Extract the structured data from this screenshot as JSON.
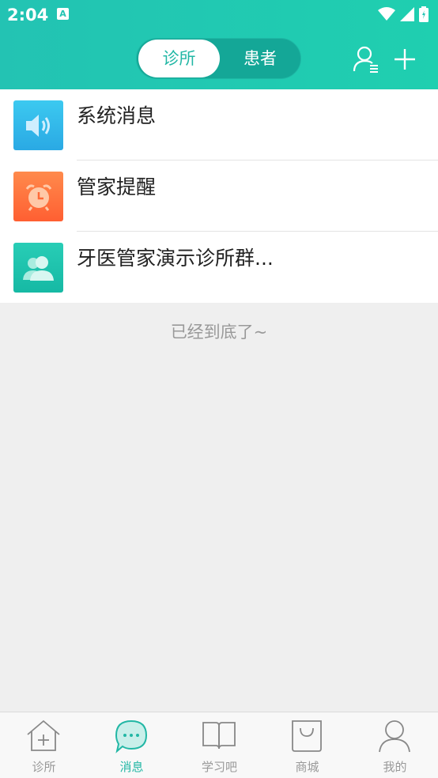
{
  "status": {
    "time": "2:04",
    "badge": "A"
  },
  "header": {
    "segments": [
      {
        "label": "诊所",
        "active": true
      },
      {
        "label": "患者",
        "active": false
      }
    ],
    "icons": [
      "contacts-icon",
      "add-icon"
    ]
  },
  "messages": [
    {
      "title": "系统消息",
      "icon": "speaker-icon",
      "color": "#2ebfe8"
    },
    {
      "title": "管家提醒",
      "icon": "alarm-clock-icon",
      "color": "#ff6e40"
    },
    {
      "title": "牙医管家演示诊所群...",
      "icon": "group-icon",
      "color": "#1fc4ad"
    }
  ],
  "end_text": "已经到底了~",
  "tabbar": {
    "items": [
      {
        "label": "诊所",
        "icon": "clinic-home-icon",
        "active": false
      },
      {
        "label": "消息",
        "icon": "chat-bubble-icon",
        "active": true
      },
      {
        "label": "学习吧",
        "icon": "book-icon",
        "active": false
      },
      {
        "label": "商城",
        "icon": "shopping-bag-icon",
        "active": false
      },
      {
        "label": "我的",
        "icon": "profile-icon",
        "active": false
      }
    ]
  },
  "colors": {
    "accent": "#22b7a5",
    "background": "#efefef"
  }
}
